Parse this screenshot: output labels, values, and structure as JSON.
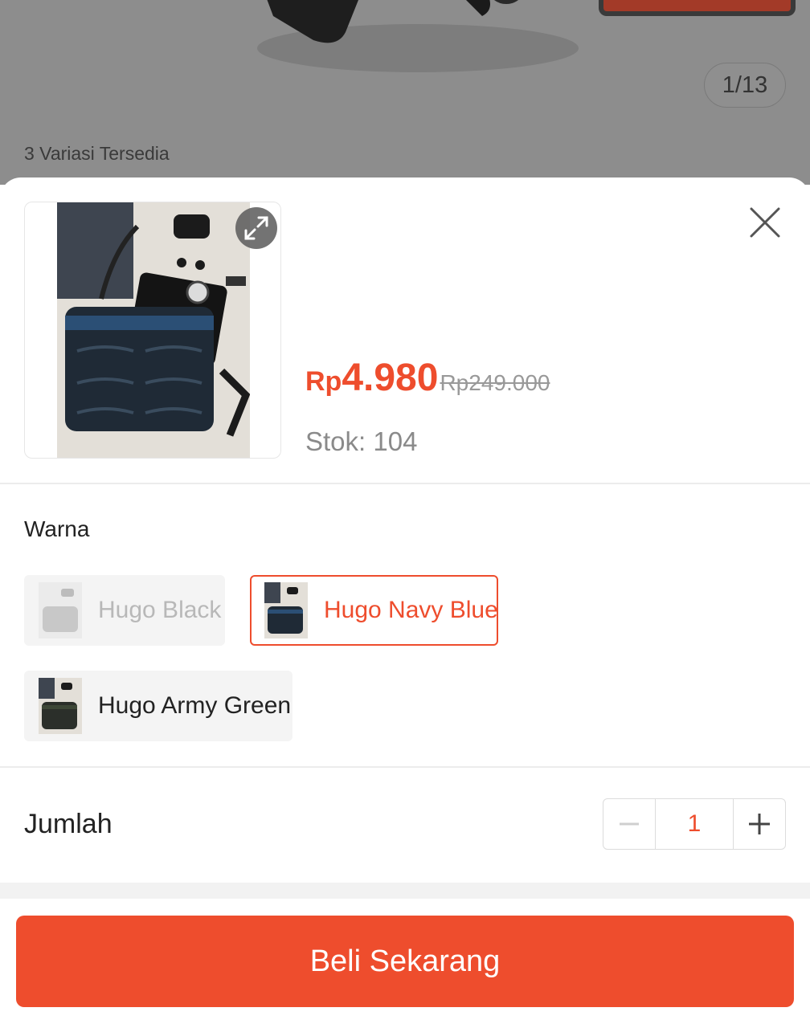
{
  "background": {
    "image_counter": "1/13",
    "variants_note": "3 Variasi Tersedia"
  },
  "product": {
    "price_currency": "Rp",
    "price_value": "4.980",
    "original_price": "Rp249.000",
    "stock": "Stok: 104"
  },
  "variation": {
    "label": "Warna",
    "options": [
      {
        "label": "Hugo Black",
        "state": "disabled"
      },
      {
        "label": "Hugo Navy Blue",
        "state": "selected"
      },
      {
        "label": "Hugo Army Green",
        "state": "available"
      }
    ]
  },
  "quantity": {
    "label": "Jumlah",
    "value": "1",
    "decrement_icon": "minus-icon",
    "increment_icon": "plus-icon"
  },
  "action": {
    "buy_label": "Beli Sekarang"
  },
  "colors": {
    "accent": "#ee4d2d",
    "muted_text": "#8a8a8a",
    "overlay": "#8d8d8d"
  }
}
